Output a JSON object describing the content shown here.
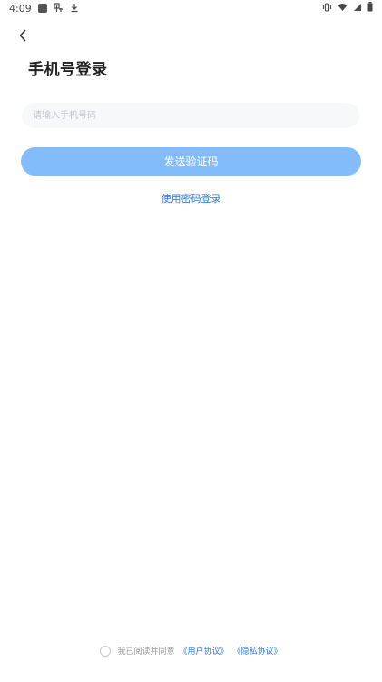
{
  "status_bar": {
    "time": "4:09",
    "left_icons": [
      "square-app-icon",
      "translate-icon",
      "download-icon"
    ],
    "right_icons": [
      "vibrate-icon",
      "wifi-icon",
      "signal-icon",
      "battery-icon"
    ]
  },
  "header": {
    "back_icon": "chevron-left-icon",
    "title": "手机号登录"
  },
  "form": {
    "phone_placeholder": "请输入手机号码",
    "phone_value": "",
    "send_button_label": "发送验证码",
    "password_login_label": "使用密码登录"
  },
  "agreement": {
    "prefix": "我已阅读并同意",
    "user_agreement": "《用户协议》",
    "privacy_policy": "《隐私协议》"
  },
  "colors": {
    "accent": "#82bcfb",
    "link": "#2f7ad9",
    "input_bg": "#f7f8fa"
  }
}
